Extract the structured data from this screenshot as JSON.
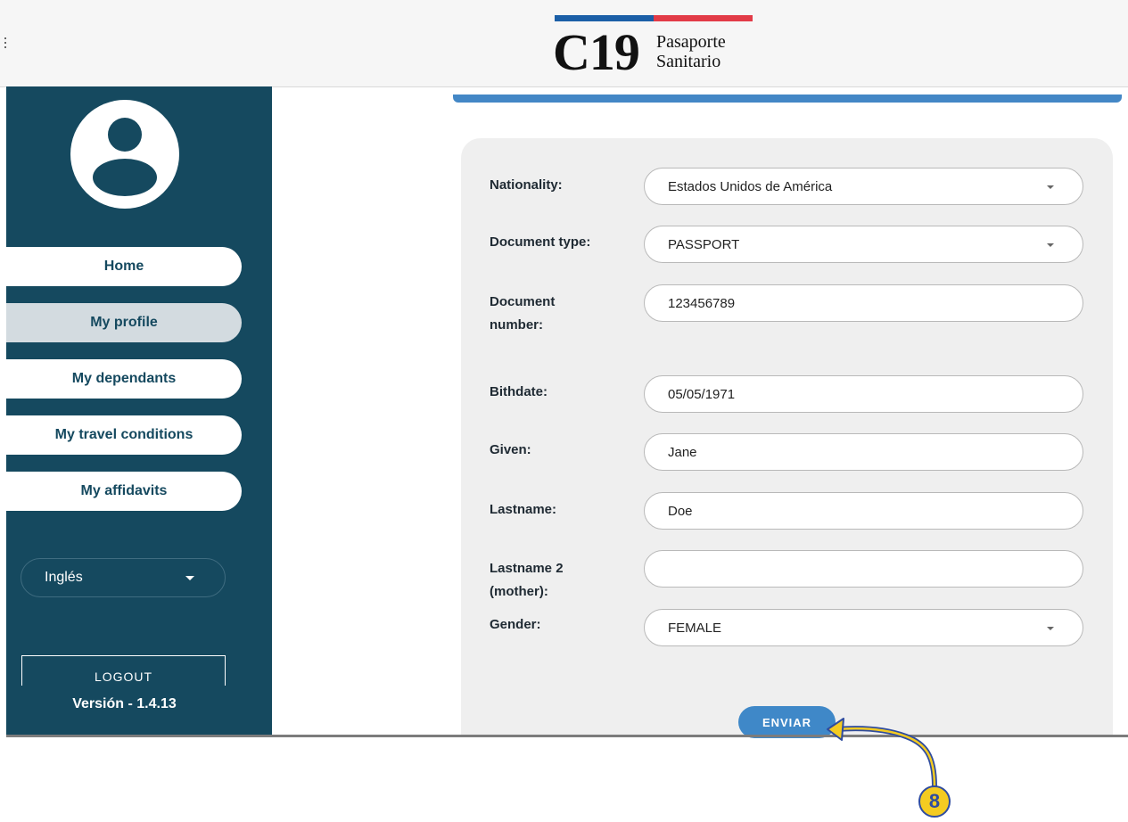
{
  "header": {
    "logo_main": "C19",
    "logo_line1": "Pasaporte",
    "logo_line2": "Sanitario",
    "flag_colors": [
      "#1b5fa7",
      "#e23b47"
    ]
  },
  "sidebar": {
    "nav": [
      {
        "label": "Home",
        "active": false
      },
      {
        "label": "My profile",
        "active": true
      },
      {
        "label": "My dependants",
        "active": false
      },
      {
        "label": "My travel conditions",
        "active": false
      },
      {
        "label": "My affidavits",
        "active": false
      }
    ],
    "language": "Inglés",
    "logout_label": "LOGOUT",
    "version": "Versión - 1.4.13"
  },
  "form": {
    "fields": [
      {
        "label": "Nationality:",
        "value": "Estados Unidos de América",
        "type": "select"
      },
      {
        "label": "Document type:",
        "value": "PASSPORT",
        "type": "select"
      },
      {
        "label": "Document number:",
        "value": "123456789",
        "type": "text"
      },
      {
        "label": "Bithdate:",
        "value": "05/05/1971",
        "type": "text"
      },
      {
        "label": "Given:",
        "value": "Jane",
        "type": "text"
      },
      {
        "label": "Lastname:",
        "value": "Doe",
        "type": "text"
      },
      {
        "label": "Lastname 2 (mother):",
        "value": "",
        "type": "text"
      },
      {
        "label": "Gender:",
        "value": "FEMALE",
        "type": "select"
      }
    ],
    "submit_label": "ENVIAR"
  },
  "annotation": {
    "step_number": "8"
  },
  "colors": {
    "sidebar": "#15495f",
    "accent": "#4387c6",
    "button": "#3f88c8",
    "badge": "#f4cb21"
  }
}
